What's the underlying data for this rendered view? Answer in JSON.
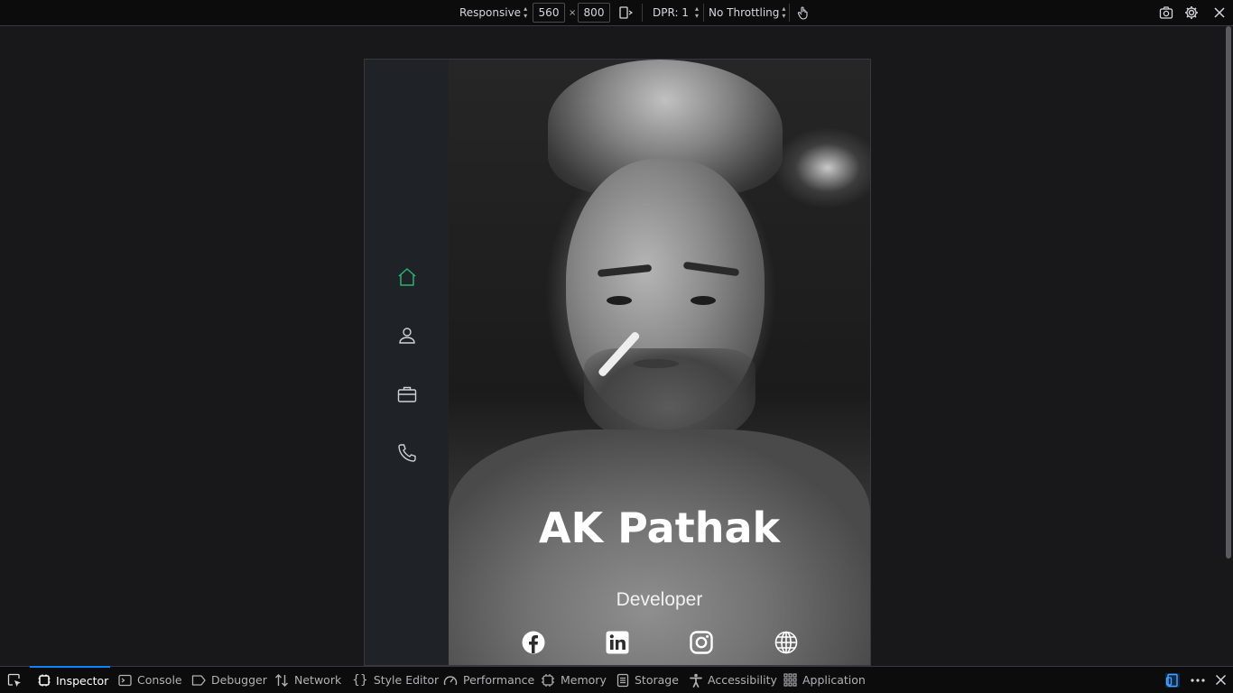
{
  "toolbar": {
    "device_selector": "Responsive",
    "width_value": "560",
    "times": "×",
    "height_value": "800",
    "dpr_label": "DPR: 1",
    "throttling": "No Throttling"
  },
  "site": {
    "nav": [
      "home-icon",
      "user-icon",
      "briefcase-icon",
      "phone-icon"
    ],
    "active_nav_color": "#2ab36b",
    "name": "AK Pathak",
    "role": "Developer",
    "social": [
      "facebook-icon",
      "linkedin-icon",
      "instagram-icon",
      "globe-icon"
    ]
  },
  "devtools": {
    "tabs": [
      {
        "label": "Inspector",
        "active": true
      },
      {
        "label": "Console"
      },
      {
        "label": "Debugger"
      },
      {
        "label": "Network"
      },
      {
        "label": "Style Editor"
      },
      {
        "label": "Performance"
      },
      {
        "label": "Memory"
      },
      {
        "label": "Storage"
      },
      {
        "label": "Accessibility"
      },
      {
        "label": "Application"
      }
    ]
  }
}
